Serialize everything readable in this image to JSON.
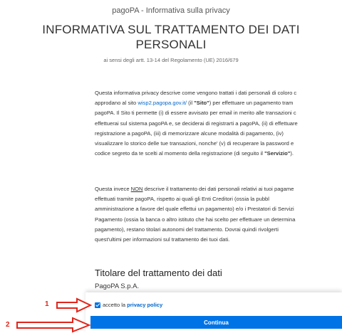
{
  "header": {
    "doc_title": "pagoPA - Informativa sulla privacy",
    "main_title_line1": "INFORMATIVA SUL TRATTAMENTO DEI DATI",
    "main_title_line2": "PERSONALI",
    "subtitle": "ai sensi degli artt. 13-14 del Regolamento (UE) 2016/679"
  },
  "para1": {
    "l1": "Questa informativa privacy descrive come vengono trattati i dati personali di coloro c",
    "l2_a": "approdano al sito ",
    "l2_link": "wisp2.pagopa.gov.it/",
    "l2_b": " (il ",
    "l2_bold": "\"Sito\"",
    "l2_c": ") per effettuare un pagamento tram",
    "l3": "pagoPA. Il Sito ti permette (i) di essere avvisato per email in merito alle transazioni c",
    "l4": "effettuerai sul sistema pagoPA e, se deciderai di registrarti a pagoPA, (ii) di effettuare",
    "l5": "registrazione a pagoPA, (iii) di memorizzare alcune modalità di pagamento, (iv)",
    "l6": "visualizzare lo storico delle tue transazioni, nonche' (v) di recuperare la password e",
    "l7_a": "codice segreto da te scelti al momento della registrazione (di seguito il ",
    "l7_bold": "\"Servizio\"",
    "l7_b": ")."
  },
  "para2": {
    "l1_a": "Questa invece ",
    "l1_u": "NON",
    "l1_b": " descrive il trattamento dei dati personali relativi ai tuoi pagame",
    "l2": "effettuati tramite pagoPA, rispetto ai quali gli Enti Creditori (ossia la pubbl",
    "l3": "amministrazione a favore del quale effettui un pagamento) e/o i Prestatori di Servizi",
    "l4": "Pagamento (ossia la banca o altro istituto che hai scelto per effettuare un determina",
    "l5": "pagamento), restano titolari autonomi del trattamento. Dovrai quindi rivolgerti",
    "l6": "quest'ultimi per informazioni sul trattamento dei tuoi dati."
  },
  "section": {
    "title": "Titolare del trattamento dei dati",
    "org": "PagoPA S.p.A."
  },
  "consent": {
    "checked": true,
    "text": "accetto la",
    "link": "privacy policy"
  },
  "continue_label": "Continua",
  "annotations": {
    "marker1": "1",
    "marker2": "2",
    "color": "#e0261c"
  },
  "colors": {
    "accent": "#0073e6",
    "link": "#0066cc"
  }
}
